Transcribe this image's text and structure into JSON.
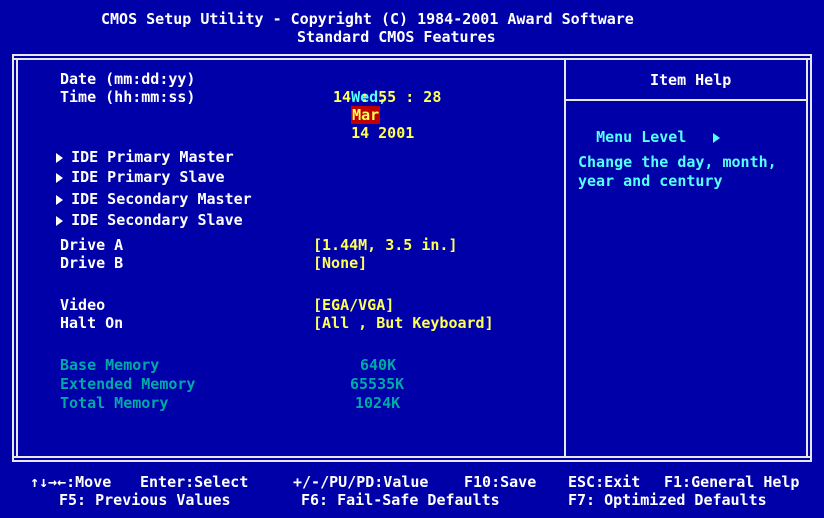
{
  "header": {
    "title": "CMOS Setup Utility - Copyright (C) 1984-2001 Award Software",
    "subtitle": "Standard CMOS Features"
  },
  "fields": {
    "date": {
      "label": "Date (mm:dd:yy)",
      "weekday": "Wed,",
      "month": "Mar",
      "dayyear": "14 2001"
    },
    "time": {
      "label": "Time (hh:mm:ss)",
      "value": "14 : 55 : 28"
    },
    "ide": [
      {
        "label": "IDE Primary Master"
      },
      {
        "label": "IDE Primary Slave"
      },
      {
        "label": "IDE Secondary Master"
      },
      {
        "label": "IDE Secondary Slave"
      }
    ],
    "drive_a": {
      "label": "Drive A",
      "value": "[1.44M, 3.5 in.]"
    },
    "drive_b": {
      "label": "Drive B",
      "value": "[None]"
    },
    "video": {
      "label": "Video",
      "value": "[EGA/VGA]"
    },
    "halt_on": {
      "label": "Halt On",
      "value": "[All , But Keyboard]"
    },
    "base_memory": {
      "label": "Base Memory",
      "value": "640K"
    },
    "extended_memory": {
      "label": "Extended Memory",
      "value": "65535K"
    },
    "total_memory": {
      "label": "Total Memory",
      "value": "1024K"
    }
  },
  "help": {
    "title": "Item Help",
    "menu_level": "Menu Level",
    "text1": "Change the day, month,",
    "text2": "year and century"
  },
  "footer": {
    "move": "↑↓→←:Move",
    "enter": "Enter:Select",
    "value": "+/-/PU/PD:Value",
    "save": "F10:Save",
    "esc": "ESC:Exit",
    "help": "F1:General Help",
    "f5": "F5: Previous Values",
    "f6": "F6: Fail-Safe Defaults",
    "f7": "F7: Optimized Defaults"
  },
  "colors": {
    "background": "#0000a8",
    "value": "#ffff55",
    "highlight": "#c00000",
    "help_text": "#55ffff",
    "disabled": "#00a8a8"
  }
}
